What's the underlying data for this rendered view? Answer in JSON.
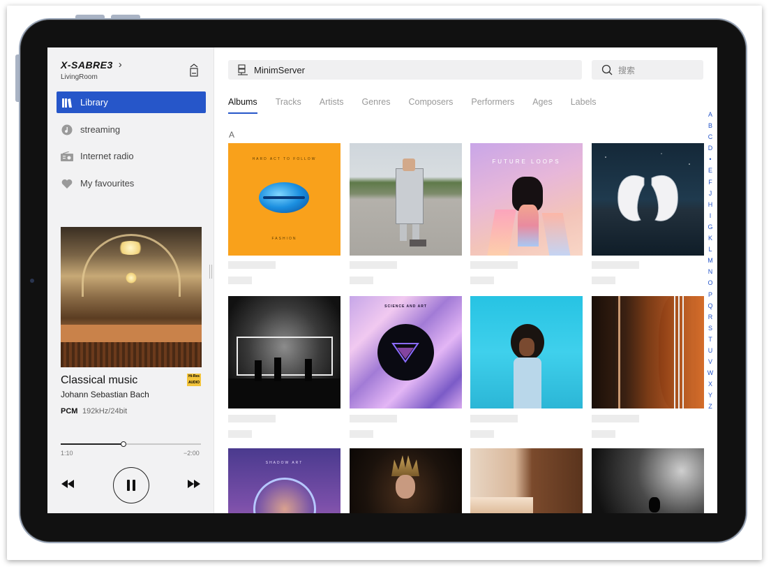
{
  "device": {
    "name": "X-SABRE3",
    "room": "LivingRoom"
  },
  "nav": [
    {
      "label": "Library",
      "icon": "library-icon",
      "active": true
    },
    {
      "label": "streaming",
      "icon": "streaming-icon",
      "active": false
    },
    {
      "label": "Internet radio",
      "icon": "radio-icon",
      "active": false
    },
    {
      "label": "My favourites",
      "icon": "heart-icon",
      "active": false
    }
  ],
  "now_playing": {
    "title": "Classical music",
    "artist": "Johann Sebastian Bach",
    "format": "PCM",
    "rate": "192kHz/24bit",
    "badge": "Hi-Res AUDIO",
    "elapsed": "1:10",
    "remaining": "−2:00",
    "progress": 0.45
  },
  "server": {
    "name": "MinimServer"
  },
  "search": {
    "placeholder": "搜索"
  },
  "tabs": [
    "Albums",
    "Tracks",
    "Artists",
    "Genres",
    "Composers",
    "Performers",
    "Ages",
    "Labels"
  ],
  "section_letter": "A",
  "album_texts": {
    "a1_top": "HARD ACT TO FOLLOW",
    "a1_bottom": "FASHION",
    "a3_top": "FUTURE LOOPS",
    "a6_top": "SCIENCE AND ART",
    "a9_top": "SHADOW ART"
  },
  "alphabet": [
    "A",
    "B",
    "C",
    "D",
    "•",
    "E",
    "F",
    "J",
    "H",
    "I",
    "G",
    "K",
    "L",
    "M",
    "N",
    "O",
    "P",
    "Q",
    "R",
    "S",
    "T",
    "U",
    "V",
    "W",
    "X",
    "Y",
    "Z"
  ],
  "colors": {
    "accent": "#2656c9",
    "hires_badge": "#f3c43a"
  }
}
